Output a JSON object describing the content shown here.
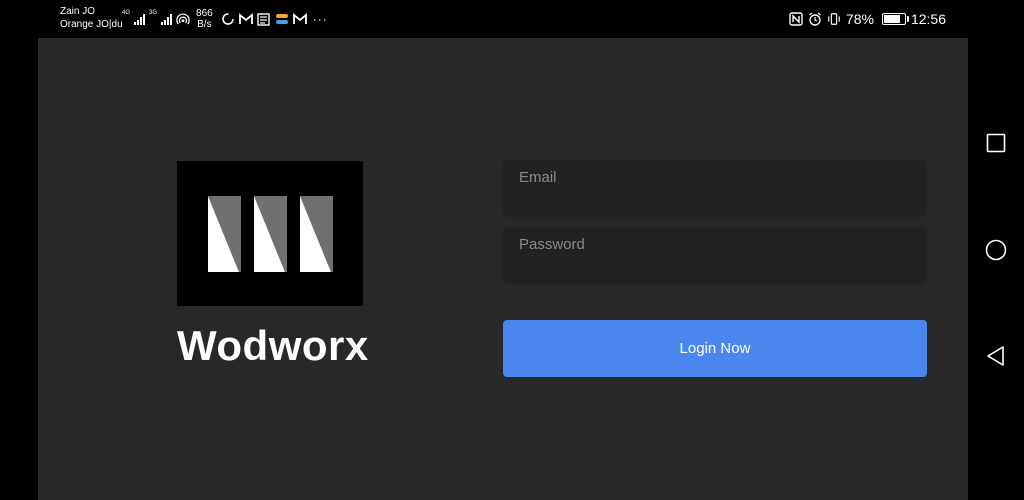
{
  "status_bar": {
    "carrier_line1": "Zain JO",
    "carrier_line2": "Orange JO|du",
    "network1": "4G",
    "network2": "3G",
    "speed_value": "866",
    "speed_unit": "B/s",
    "battery_text": "78%",
    "battery_level": 0.78,
    "time": "12:56",
    "more_dots": "···"
  },
  "brand": {
    "name": "Wodworx"
  },
  "login_form": {
    "email_placeholder": "Email",
    "password_placeholder": "Password",
    "submit_label": "Login Now"
  },
  "colors": {
    "background": "#282828",
    "field_bg": "#222222",
    "accent": "#4a86ee"
  }
}
